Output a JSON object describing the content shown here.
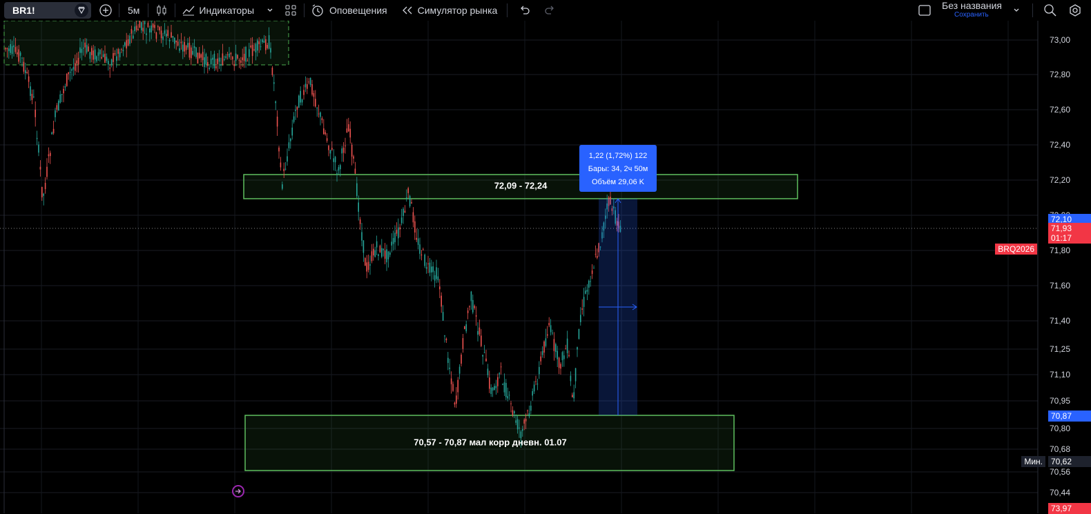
{
  "toolbar": {
    "symbol": "BR1!",
    "interval": "5м",
    "indicators_label": "Индикаторы",
    "alerts_label": "Оповещения",
    "replay_label": "Симулятор рынка",
    "layout_name": "Без названия",
    "save_label": "Сохранить"
  },
  "price_axis": {
    "ticks": [
      "73,00",
      "72,80",
      "72,60",
      "72,40",
      "72,20",
      "72,00",
      "71,80",
      "71,60",
      "71,40",
      "71,25",
      "71,10",
      "70,95",
      "70,80",
      "70,68",
      "70,56",
      "70,44"
    ],
    "tags": {
      "upper": "72,10",
      "current": "71,93",
      "countdown": "01:17",
      "lower": "70,87",
      "min": "70,62",
      "min_label": "Мин.",
      "bottom": "73,97"
    },
    "ticker_tag": "BRQ2026"
  },
  "zones": {
    "upper": "72,09 - 72,24",
    "lower": "70,57 - 70,87 мал корр дневн. 01.07"
  },
  "measure": {
    "line1": "1,22 (1,72%) 122",
    "line2": "Бары: 34, 2ч 50м",
    "line3": "Объём 29,06 K"
  },
  "colors": {
    "up": "#26a69a",
    "down": "#ef5350",
    "accent": "#2962ff",
    "zone_border": "#5fbf5f"
  },
  "icons": {
    "search": "search-icon",
    "add": "plus-circle-icon",
    "bars": "candles-icon",
    "indicators": "indicators-icon",
    "layouts": "grid-icon",
    "alert": "alarm-icon",
    "replay": "rewind-icon",
    "undo": "undo-icon",
    "redo": "redo-icon",
    "fullscreen": "square-icon",
    "quicksearch": "magnifier-icon",
    "settings": "gear-icon"
  }
}
